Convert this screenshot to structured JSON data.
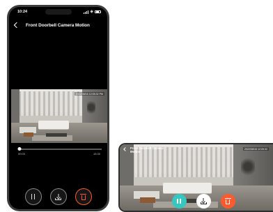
{
  "portrait": {
    "status_time": "10:24",
    "title": "Front Doorbell Camera Motion",
    "timestamp": "2022/08/16 12:05:32 PM",
    "playback": {
      "progress": 0.02,
      "start_time": "00:00",
      "end_time": "15:30"
    },
    "controls": {
      "pause_icon": "pause-icon",
      "download_icon": "download-icon",
      "delete_icon": "trash-icon"
    }
  },
  "landscape": {
    "title_line1": "Front Doorbell Camera",
    "title_line2": "Motion",
    "timestamp": "2022/08/16 12:05:32",
    "controls": {
      "pause_icon": "pause-icon",
      "download_icon": "download-icon",
      "delete_icon": "trash-icon"
    }
  },
  "colors": {
    "accent_teal": "#35c7c0",
    "delete_orange": "#ff5a2e",
    "background_black": "#000000"
  }
}
